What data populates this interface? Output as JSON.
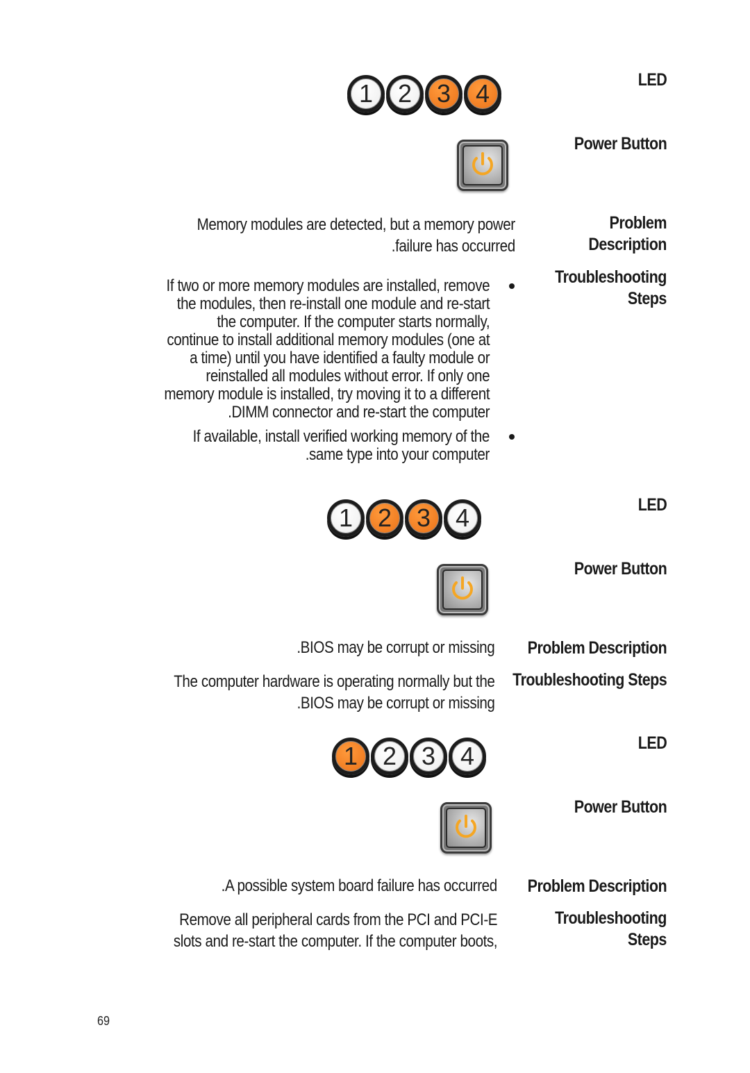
{
  "page": {
    "number": "69"
  },
  "colors": {
    "led_on": "#f07d22",
    "led_off": "#f2f2f2",
    "power_glyph": "#f5a623"
  },
  "sections": [
    {
      "led_label": "LED",
      "leds": [
        {
          "number": "1",
          "state": "off"
        },
        {
          "number": "2",
          "state": "off"
        },
        {
          "number": "3",
          "state": "on"
        },
        {
          "number": "4",
          "state": "on"
        }
      ],
      "power_button_label": "Power Button",
      "power_button_state": "amber",
      "problem_label_lines": [
        "Problem",
        "Description"
      ],
      "problem_lines": [
        "Memory modules are detected, but a memory power",
        ".failure has occurred"
      ],
      "troubleshooting_label_lines": [
        "Troubleshooting",
        "Steps"
      ],
      "steps": [
        {
          "lines": [
            "If two or more memory modules are installed, remove",
            "the modules, then re-install one module and re-start",
            "the computer. If the computer starts normally,",
            "continue to install additional memory modules (one at",
            "a time) until you have identified a faulty module or",
            "reinstalled all modules without error. If only one",
            "memory module is installed, try moving it to a different",
            ".DIMM connector and re-start the computer"
          ]
        },
        {
          "lines": [
            "If available, install verified working memory of the",
            ".same type into your computer"
          ]
        }
      ]
    },
    {
      "led_label": "LED",
      "leds": [
        {
          "number": "1",
          "state": "off"
        },
        {
          "number": "2",
          "state": "on"
        },
        {
          "number": "3",
          "state": "on"
        },
        {
          "number": "4",
          "state": "off"
        }
      ],
      "power_button_label": "Power Button",
      "power_button_state": "amber",
      "problem_label": "Problem Description",
      "problem_lines": [
        ".BIOS may be corrupt or missing"
      ],
      "troubleshooting_label": "Troubleshooting Steps",
      "steps_lines": [
        "The computer hardware is operating normally but the",
        ".BIOS may be corrupt or missing"
      ]
    },
    {
      "led_label": "LED",
      "leds": [
        {
          "number": "1",
          "state": "on"
        },
        {
          "number": "2",
          "state": "off"
        },
        {
          "number": "3",
          "state": "off"
        },
        {
          "number": "4",
          "state": "off"
        }
      ],
      "power_button_label": "Power Button",
      "power_button_state": "amber",
      "problem_label": "Problem Description",
      "problem_lines": [
        ".A possible system board failure has occurred"
      ],
      "troubleshooting_label_lines": [
        "Troubleshooting",
        "Steps"
      ],
      "steps_lines": [
        "Remove all peripheral cards from the PCI and PCI-E",
        "slots and re-start the computer. If the computer boots,"
      ]
    }
  ]
}
